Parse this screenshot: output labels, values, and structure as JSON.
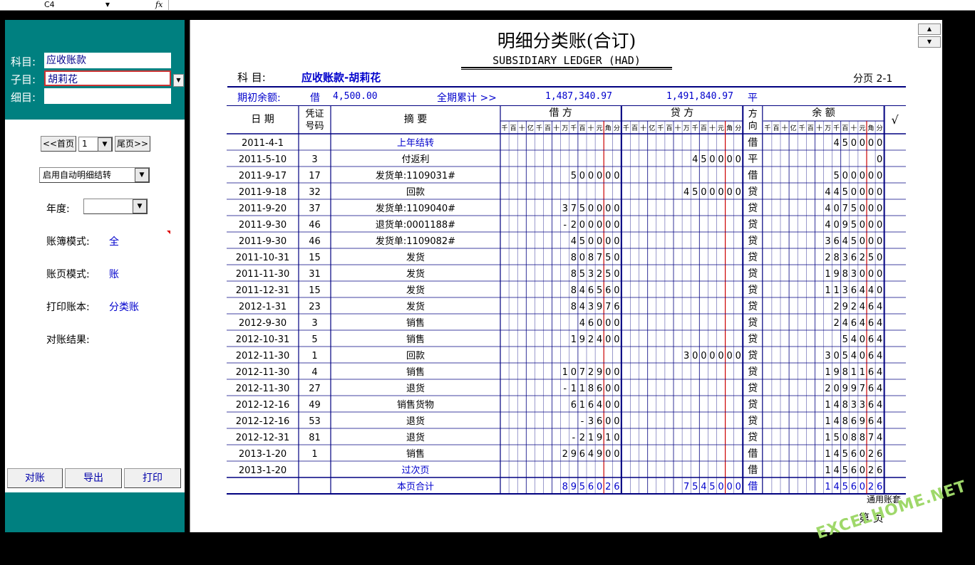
{
  "formula_bar": {
    "cell_ref": "C4",
    "fx": "fx"
  },
  "sidebar": {
    "subject_label": "科目:",
    "subject_value": "应收账款",
    "subsubject_label": "子目:",
    "subsubject_value": "胡莉花",
    "detail_label": "细目:",
    "detail_value": "",
    "first_page": "<<首页",
    "page_select": "1",
    "last_page": "尾页>>",
    "auto_carry": "启用自动明细结转",
    "year_label": "年度:",
    "year_value": "",
    "book_mode_label": "账簿模式:",
    "book_mode_value": "全",
    "page_mode_label": "账页模式:",
    "page_mode_value": "账",
    "print_book_label": "打印账本:",
    "print_book_value": "分类账",
    "reconcile_label": "对账结果:",
    "btn_reconcile": "对账",
    "btn_export": "导出",
    "btn_print": "打印"
  },
  "ledger_page": {
    "title": "明细分类账(合订)",
    "subtitle": "SUBSIDIARY LEDGER (HAD)",
    "account_label": "科    目:",
    "account_value": "应收账款-胡莉花",
    "page_info": "分页 2-1",
    "opening_label": "期初余额:",
    "opening_dir": "借",
    "opening_amount": "4,500.00",
    "cumulative_label": "全期累计 >>",
    "cum_debit": "1,487,340.97",
    "cum_credit": "1,491,840.97",
    "cum_dir": "平",
    "footer_note": "通用账套",
    "page_no": "第    页",
    "watermark": "EXCELHOME.NET"
  },
  "table": {
    "headers": {
      "date": "日  期",
      "voucher": "凭证\n号码",
      "summary": "摘    要",
      "debit": "借    方",
      "credit": "贷    方",
      "direction": "方\n向",
      "balance": "余    额",
      "check": "√"
    },
    "digit_units": [
      "千",
      "百",
      "十",
      "亿",
      "千",
      "百",
      "十",
      "万",
      "千",
      "百",
      "十",
      "元",
      "角",
      "分"
    ],
    "rows": [
      {
        "date": "2011-4-1",
        "voucher": "",
        "summary": "上年结转",
        "blue": true,
        "debit": "",
        "credit": "",
        "dir": "借",
        "balance": "450000"
      },
      {
        "date": "2011-5-10",
        "voucher": "3",
        "summary": "付返利",
        "blue": false,
        "debit": "",
        "credit": "450000",
        "dir": "平",
        "balance": "0"
      },
      {
        "date": "2011-9-17",
        "voucher": "17",
        "summary": "发货单:1109031#",
        "blue": false,
        "debit": "500000",
        "credit": "",
        "dir": "借",
        "balance": "500000"
      },
      {
        "date": "2011-9-18",
        "voucher": "32",
        "summary": "回款",
        "blue": false,
        "debit": "",
        "credit": "4500000",
        "dir": "贷",
        "balance": "4450000"
      },
      {
        "date": "2011-9-20",
        "voucher": "37",
        "summary": "发货单:1109040#",
        "blue": false,
        "debit": "3750000",
        "credit": "",
        "dir": "贷",
        "balance": "4075000"
      },
      {
        "date": "2011-9-30",
        "voucher": "46",
        "summary": "退货单:0001188#",
        "blue": false,
        "debit": "-200000",
        "credit": "",
        "dir": "贷",
        "balance": "4095000"
      },
      {
        "date": "2011-9-30",
        "voucher": "46",
        "summary": "发货单:1109082#",
        "blue": false,
        "debit": "450000",
        "credit": "",
        "dir": "贷",
        "balance": "3645000"
      },
      {
        "date": "2011-10-31",
        "voucher": "15",
        "summary": "发货",
        "blue": false,
        "debit": "808750",
        "credit": "",
        "dir": "贷",
        "balance": "2836250"
      },
      {
        "date": "2011-11-30",
        "voucher": "31",
        "summary": "发货",
        "blue": false,
        "debit": "853250",
        "credit": "",
        "dir": "贷",
        "balance": "1983000"
      },
      {
        "date": "2011-12-31",
        "voucher": "15",
        "summary": "发货",
        "blue": false,
        "debit": "846560",
        "credit": "",
        "dir": "贷",
        "balance": "1136440"
      },
      {
        "date": "2012-1-31",
        "voucher": "23",
        "summary": "发货",
        "blue": false,
        "debit": "843976",
        "credit": "",
        "dir": "贷",
        "balance": "292464"
      },
      {
        "date": "2012-9-30",
        "voucher": "3",
        "summary": "销售",
        "blue": false,
        "debit": "46000",
        "credit": "",
        "dir": "贷",
        "balance": "246464"
      },
      {
        "date": "2012-10-31",
        "voucher": "5",
        "summary": "销售",
        "blue": false,
        "debit": "192400",
        "credit": "",
        "dir": "贷",
        "balance": "54064"
      },
      {
        "date": "2012-11-30",
        "voucher": "1",
        "summary": "回款",
        "blue": false,
        "debit": "",
        "credit": "3000000",
        "dir": "贷",
        "balance": "3054064"
      },
      {
        "date": "2012-11-30",
        "voucher": "4",
        "summary": "销售",
        "blue": false,
        "debit": "1072900",
        "credit": "",
        "dir": "贷",
        "balance": "1981164"
      },
      {
        "date": "2012-11-30",
        "voucher": "27",
        "summary": "退货",
        "blue": false,
        "debit": "-118600",
        "credit": "",
        "dir": "贷",
        "balance": "2099764"
      },
      {
        "date": "2012-12-16",
        "voucher": "49",
        "summary": "销售货物",
        "blue": false,
        "debit": "616400",
        "credit": "",
        "dir": "贷",
        "balance": "1483364"
      },
      {
        "date": "2012-12-16",
        "voucher": "53",
        "summary": "退货",
        "blue": false,
        "debit": "-3600",
        "credit": "",
        "dir": "贷",
        "balance": "1486964"
      },
      {
        "date": "2012-12-31",
        "voucher": "81",
        "summary": "退货",
        "blue": false,
        "debit": "-21910",
        "credit": "",
        "dir": "贷",
        "balance": "1508874"
      },
      {
        "date": "2013-1-20",
        "voucher": "1",
        "summary": "销售",
        "blue": false,
        "debit": "2964900",
        "credit": "",
        "dir": "借",
        "balance": "1456026"
      },
      {
        "date": "2013-1-20",
        "voucher": "",
        "summary": "过次页",
        "blue": true,
        "debit": "",
        "credit": "",
        "dir": "借",
        "balance": "1456026"
      },
      {
        "date": "",
        "voucher": "",
        "summary": "本页合计",
        "blue": true,
        "debit": "8956026",
        "credit": "7545000",
        "dir": "借",
        "balance": "1456026",
        "total": true
      }
    ]
  },
  "colors": {
    "teal": "#008080",
    "ledger_line": "#000080",
    "red_line": "#cc0000",
    "blue_text": "#0000cc"
  }
}
